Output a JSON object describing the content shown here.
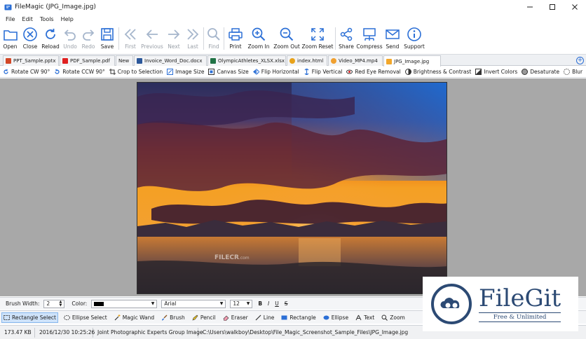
{
  "window": {
    "title": "FileMagic (JPG_Image.jpg)"
  },
  "menu": [
    "File",
    "Edit",
    "Tools",
    "Help"
  ],
  "toolbar": {
    "open": "Open",
    "close": "Close",
    "reload": "Reload",
    "undo": "Undo",
    "redo": "Redo",
    "save": "Save",
    "first": "First",
    "previous": "Previous",
    "next": "Next",
    "last": "Last",
    "find": "Find",
    "print": "Print",
    "zoom_in": "Zoom In",
    "zoom_out": "Zoom Out",
    "zoom_reset": "Zoom Reset",
    "share": "Share",
    "compress": "Compress",
    "send": "Send",
    "support": "Support"
  },
  "tabs": [
    {
      "label": "PPT_Sample.pptx",
      "color": "#d24726"
    },
    {
      "label": "PDF_Sample.pdf",
      "color": "#e02020"
    },
    {
      "label": "New",
      "color": ""
    },
    {
      "label": "Invoice_Word_Doc.docx",
      "color": "#2b579a"
    },
    {
      "label": "OlympicAthletes_XLSX.xlsx",
      "color": "#217346"
    },
    {
      "label": "index.html",
      "color": "#e8a21a"
    },
    {
      "label": "Video_MP4.mp4",
      "color": "#f0a030"
    },
    {
      "label": "JPG_Image.jpg",
      "color": "#f2a72b"
    }
  ],
  "edit_tools": [
    "Rotate CW 90°",
    "Rotate CCW 90°",
    "Crop to Selection",
    "Image Size",
    "Canvas Size",
    "Flip Horizontal",
    "Flip Vertical",
    "Red Eye Removal",
    "Brightness & Contrast",
    "Invert Colors",
    "Desaturate",
    "Blur"
  ],
  "image_watermark": {
    "text": "FILECR",
    "sub": ".com"
  },
  "properties": {
    "brush_width_label": "Brush Width:",
    "brush_width_value": "2",
    "color_label": "Color:",
    "color_value": "#000000",
    "font": "Arial",
    "font_size": "12",
    "bold": "B",
    "italic": "I",
    "underline": "U",
    "strike": "S"
  },
  "draw_tools": [
    {
      "label": "Rectangle Select",
      "active": true
    },
    {
      "label": "Ellipse Select",
      "active": false
    },
    {
      "label": "Magic Wand",
      "active": false
    },
    {
      "label": "Brush",
      "active": false
    },
    {
      "label": "Pencil",
      "active": false
    },
    {
      "label": "Eraser",
      "active": false
    },
    {
      "label": "Line",
      "active": false
    },
    {
      "label": "Rectangle",
      "active": false
    },
    {
      "label": "Ellipse",
      "active": false
    },
    {
      "label": "Text",
      "active": false
    },
    {
      "label": "Zoom",
      "active": false
    }
  ],
  "status": {
    "size": "173.47 KB",
    "date": "2016/12/30 10:25:26",
    "type": "Joint Photographic Experts Group Image",
    "path": "C:\\Users\\walkboy\\Desktop\\File_Magic_Screenshot_Sample_Files\\JPG_Image.jpg"
  },
  "badge": {
    "brand": "FileGit",
    "tagline": "Free & Unlimited"
  },
  "colors": {
    "accent": "#2b6fd6",
    "badge": "#2c4a74"
  }
}
